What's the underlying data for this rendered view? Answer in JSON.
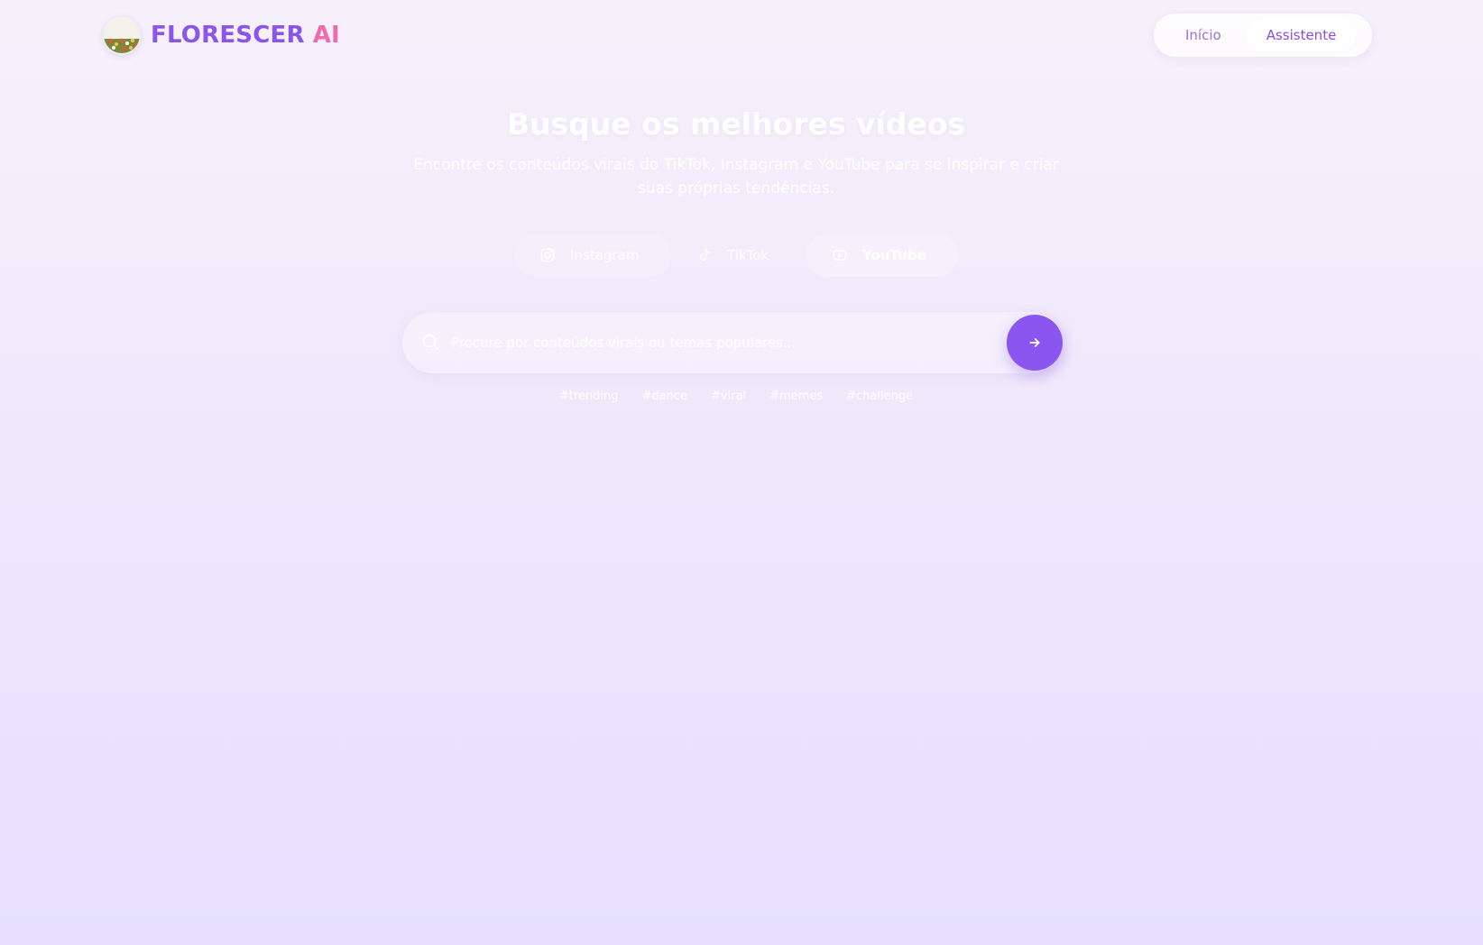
{
  "header": {
    "brand": "FLORESCER",
    "brand_suffix": "AI",
    "logo_icon": "flower-field-logo",
    "nav": [
      {
        "label": "Início",
        "active": false
      },
      {
        "label": "Assistente",
        "active": true
      }
    ]
  },
  "hero": {
    "title": "Busque os melhores vídeos",
    "subtitle": "Encontre os conteúdos virais do TikTok, Instagram e YouTube para se inspirar e criar suas próprias tendências."
  },
  "platforms": {
    "selected": "YouTube",
    "tabs": [
      {
        "label": "Instagram",
        "icon": "instagram-icon"
      },
      {
        "label": "TikTok",
        "icon": "tiktok-icon"
      },
      {
        "label": "YouTube",
        "icon": "youtube-icon"
      }
    ]
  },
  "search": {
    "placeholder": "Procure por conteúdos virais ou temas populares...",
    "value": "",
    "icon": "search-icon",
    "submit_icon": "arrow-right-icon"
  },
  "hashtags": [
    "#trending",
    "#dance",
    "#viral",
    "#memes",
    "#challenge"
  ],
  "colors": {
    "accent": "#8b55f0",
    "brand_purple": "#8a55e8",
    "brand_pink": "#f06ab0",
    "background_top": "#f6f1fb",
    "background_bottom": "#e6dfff"
  }
}
